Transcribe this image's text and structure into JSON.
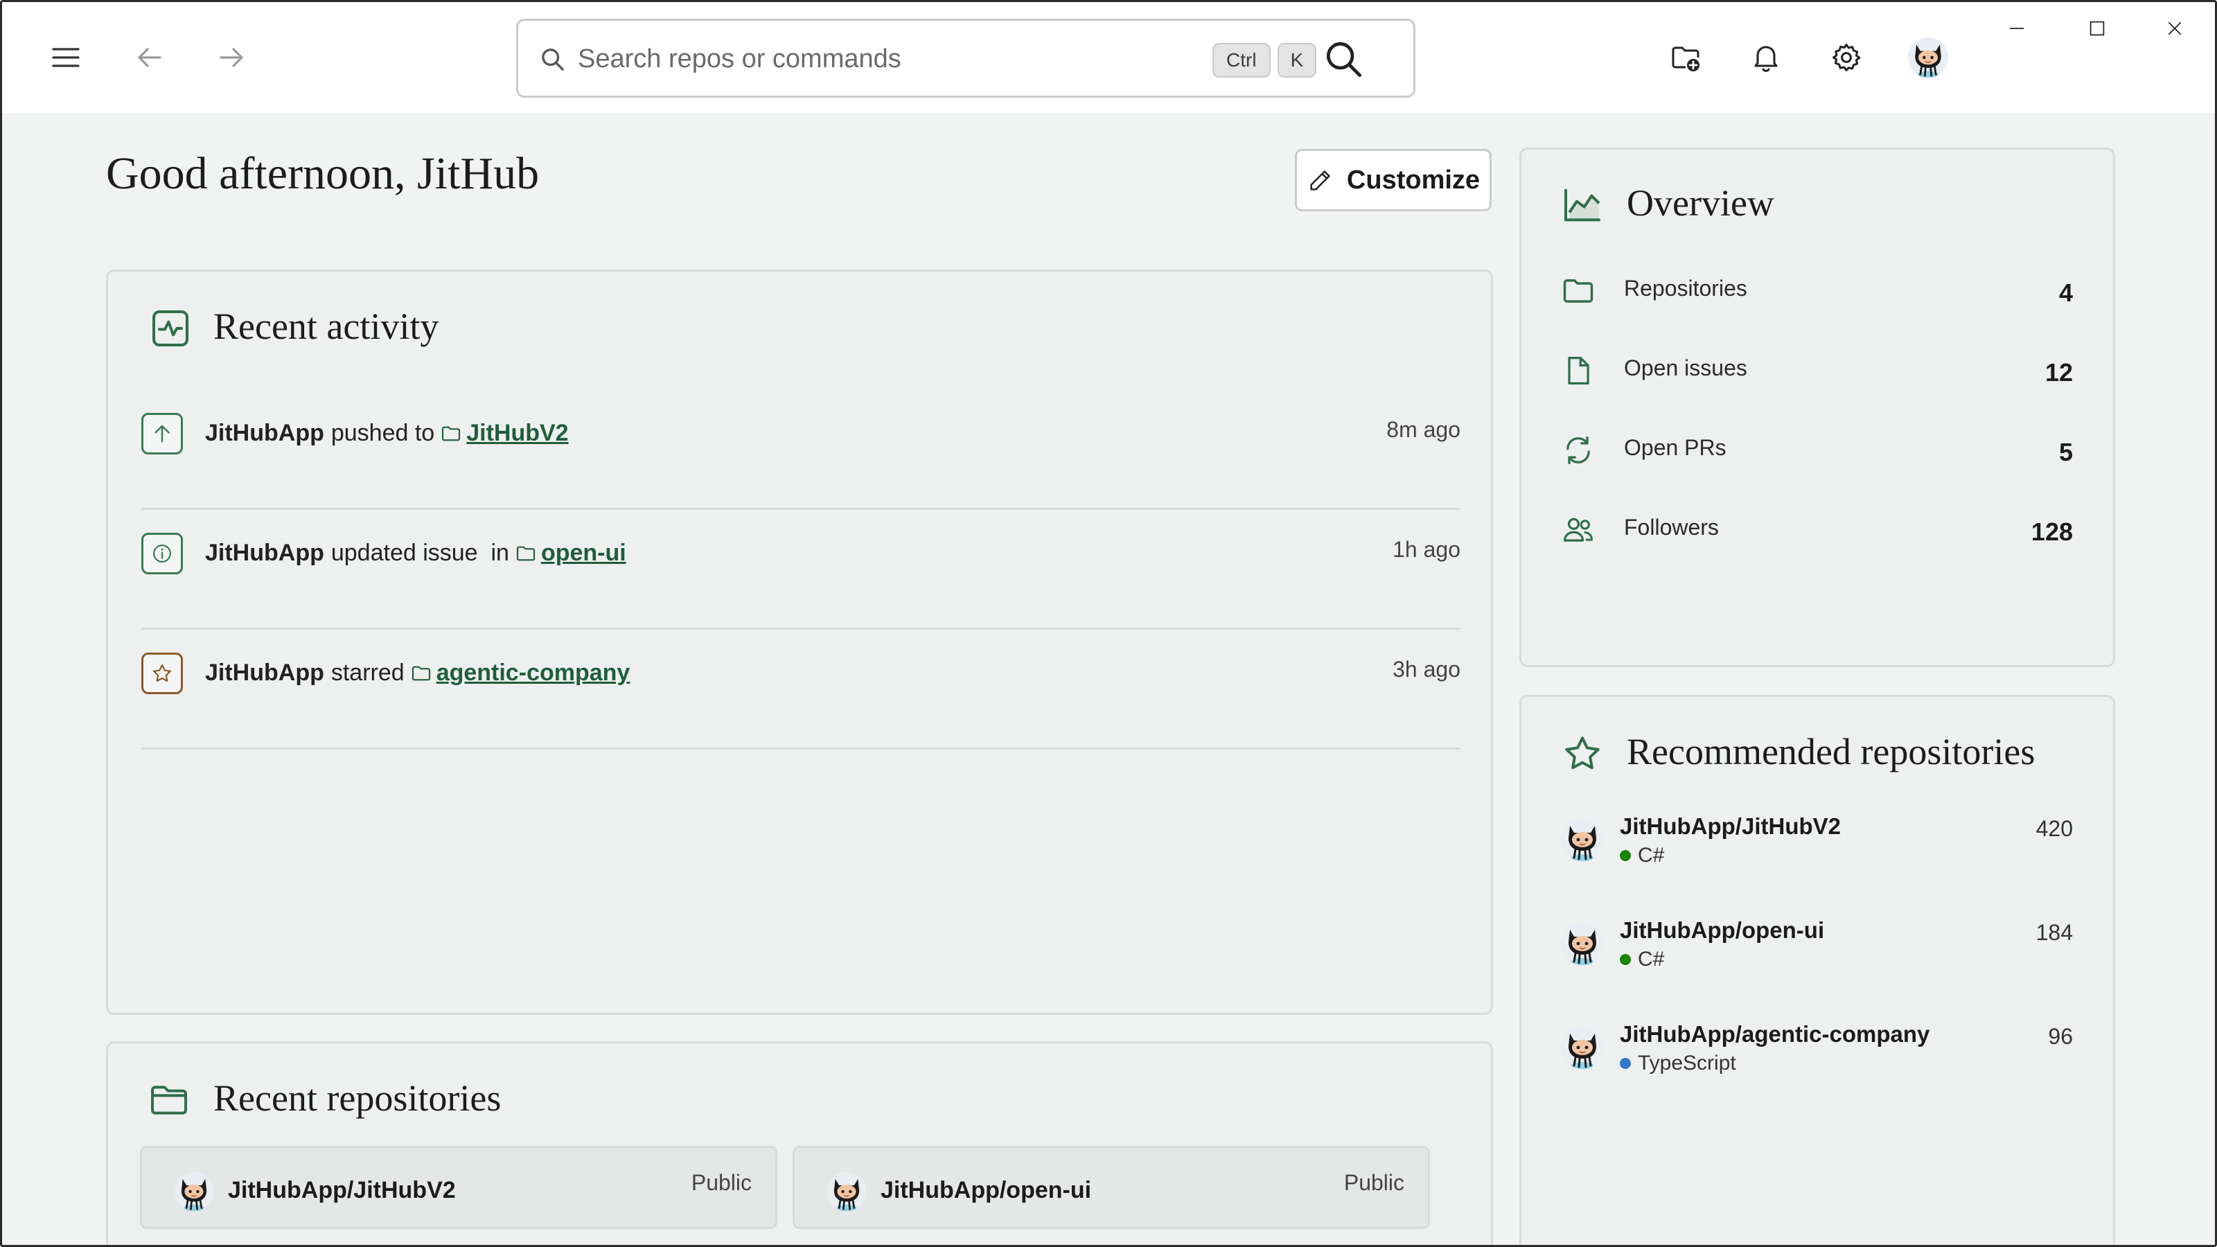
{
  "search": {
    "placeholder": "Search repos or commands",
    "shortcut_keys": [
      "Ctrl",
      "K"
    ]
  },
  "header_icons": [
    "menu-icon",
    "back-arrow-icon",
    "forward-arrow-icon",
    "new-folder-icon",
    "bell-icon",
    "gear-icon",
    "avatar"
  ],
  "greeting": "Good afternoon, JitHub",
  "customize_label": "Customize",
  "recent_activity": {
    "title": "Recent activity",
    "items": [
      {
        "user": "JitHubApp",
        "action": "pushed to",
        "repo": "JitHubV2",
        "time": "8m ago",
        "icon": "arrow-up-icon",
        "color": "#3c7a57"
      },
      {
        "user": "JitHubApp",
        "action": "updated issue  in",
        "repo": "open-ui",
        "time": "1h ago",
        "icon": "info-icon",
        "color": "#3c7a57"
      },
      {
        "user": "JitHubApp",
        "action": "starred",
        "repo": "agentic-company",
        "time": "3h ago",
        "icon": "star-icon",
        "color": "#8a5a2b"
      }
    ]
  },
  "recent_repositories": {
    "title": "Recent repositories",
    "items": [
      {
        "name": "JitHubApp/JitHubV2",
        "visibility": "Public"
      },
      {
        "name": "JitHubApp/open-ui",
        "visibility": "Public"
      }
    ]
  },
  "overview": {
    "title": "Overview",
    "items": [
      {
        "label": "Repositories",
        "value": "4",
        "icon": "folder-icon"
      },
      {
        "label": "Open issues",
        "value": "12",
        "icon": "file-icon"
      },
      {
        "label": "Open PRs",
        "value": "5",
        "icon": "sync-icon"
      },
      {
        "label": "Followers",
        "value": "128",
        "icon": "people-icon"
      }
    ]
  },
  "recommended": {
    "title": "Recommended repositories",
    "items": [
      {
        "name": "JitHubApp/JitHubV2",
        "language": "C#",
        "lang_color": "#178600",
        "stars": "420"
      },
      {
        "name": "JitHubApp/open-ui",
        "language": "C#",
        "lang_color": "#178600",
        "stars": "184"
      },
      {
        "name": "JitHubApp/agentic-company",
        "language": "TypeScript",
        "lang_color": "#3178c6",
        "stars": "96"
      }
    ]
  },
  "colors": {
    "accent": "#1f5e3b",
    "background": "#f1f3f2",
    "card": "#eef0ef"
  }
}
